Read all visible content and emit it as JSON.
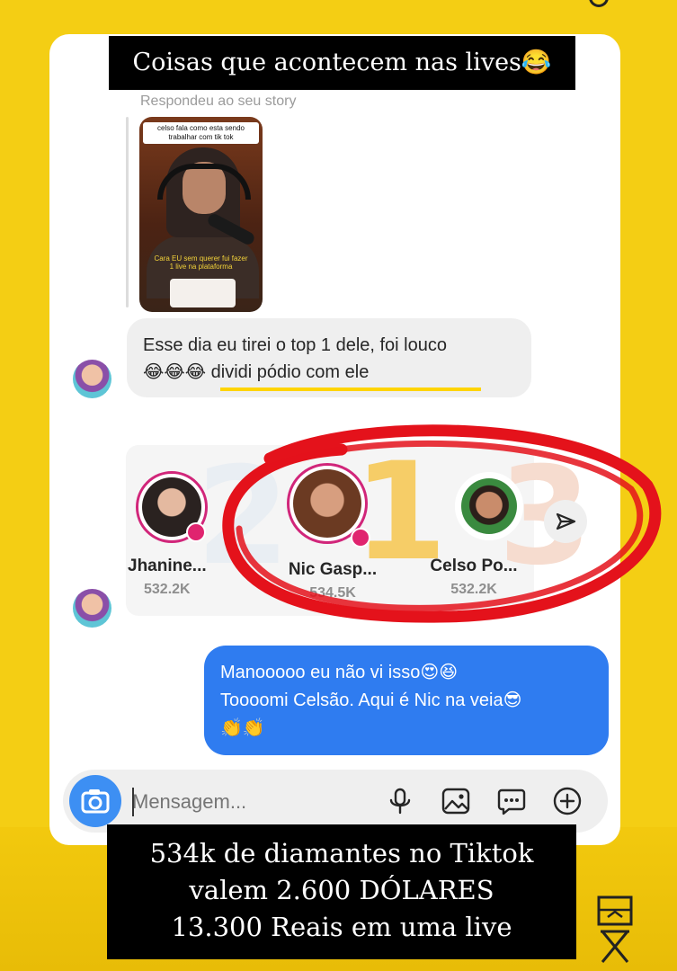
{
  "overlay": {
    "top_caption": "Coisas que acontecem nas lives😂",
    "bottom_caption_lines": [
      "534k de diamantes no Tiktok",
      "valem 2.600 DÓLARES",
      "13.300 Reais em uma live"
    ]
  },
  "chat": {
    "story_reply_label": "Respondeu ao seu story",
    "story_thumbnail": {
      "caption_top": "celso fala como esta sendo trabalhar com tik tok",
      "caption_bottom": "Cara EU sem querer fui fazer 1 live na plataforma"
    },
    "incoming_message": {
      "line1": "Esse dia eu tirei o top 1 dele, foi louco",
      "line2": "😂😂😂 dividi pódio com ele"
    },
    "podium": [
      {
        "rank": "2",
        "name": "Jhanine...",
        "score": "532.2K"
      },
      {
        "rank": "1",
        "name": "Nic Gasp...",
        "score": "534.5K"
      },
      {
        "rank": "3",
        "name": "Celso Po...",
        "score": "532.2K"
      }
    ],
    "outgoing_message": {
      "line1": "Manooooo eu não vi isso😍😆",
      "line2": "Toooomi Celsão. Aqui é Nic na veia😎",
      "line3": "👏👏"
    }
  },
  "composer": {
    "placeholder": "Mensagem..."
  },
  "icons": {
    "camera": "camera-icon",
    "mic": "microphone-icon",
    "gallery": "image-icon",
    "sticker": "chat-bubble-icon",
    "add": "plus-circle-icon",
    "share": "send-icon"
  },
  "colors": {
    "background": "#f4ce14",
    "outgoing_bubble": "#2f7cf0",
    "incoming_bubble": "#efefef",
    "highlight_circle": "#e4121b",
    "live_badge": "#e0246f"
  }
}
